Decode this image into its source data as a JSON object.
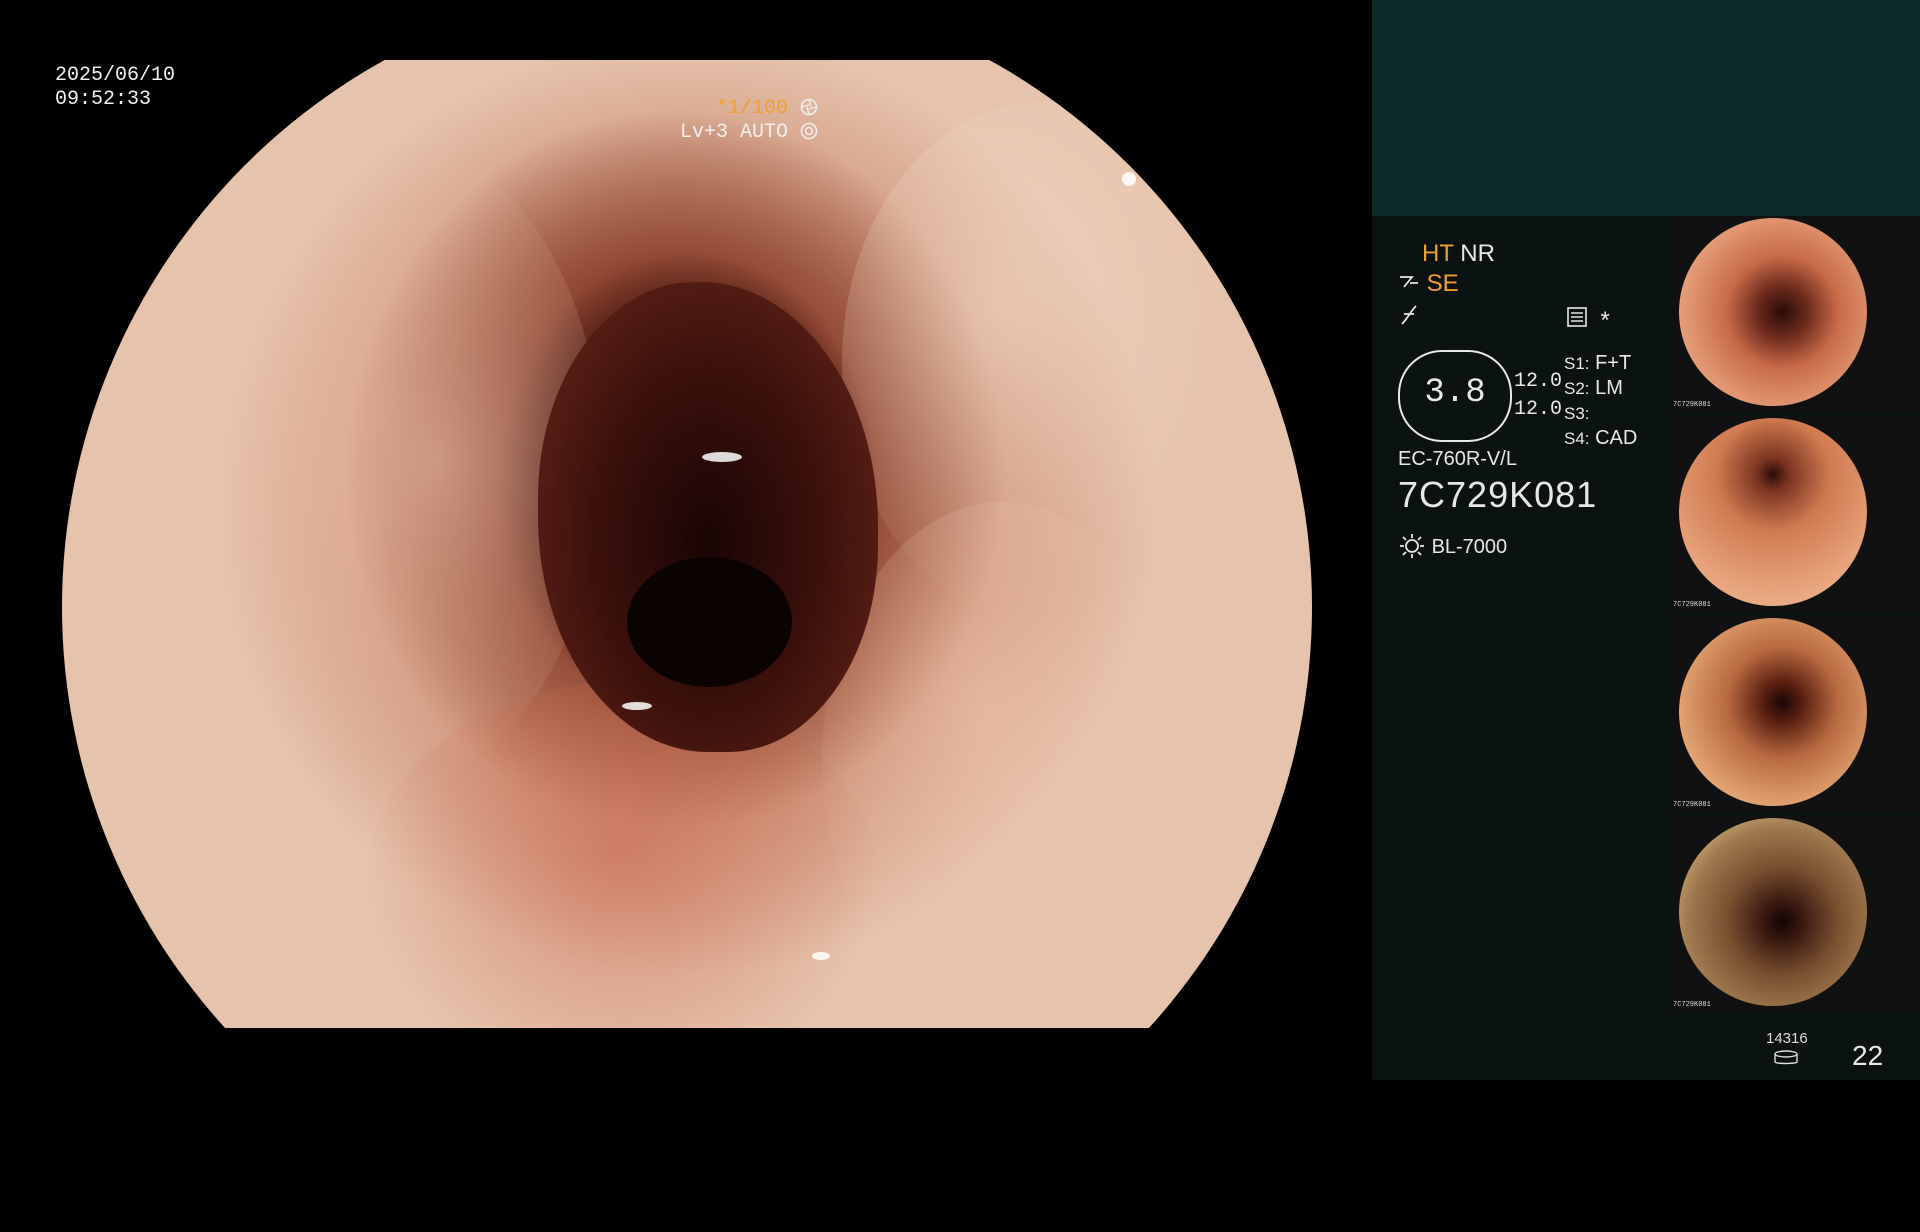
{
  "overlay": {
    "date": "2025/06/10",
    "time": "09:52:33",
    "shutter_value": "*1/100",
    "shutter_icon": "aperture-icon",
    "level_value": "Lv+3 AUTO",
    "level_icon": "auto-exposure-icon"
  },
  "panel": {
    "ht_label": "HT",
    "nr_label": "NR",
    "se_label": "SE",
    "se_icon": "structure-enhance-icon",
    "freeze_icon": "freeze-icon",
    "memo_icon": "document-icon",
    "asterisk": "*",
    "scope_value": "3.8",
    "ch1": "12.0",
    "ch2": "12.0",
    "s1_label": "S1:",
    "s1_value": "F+T",
    "s2_label": "S2:",
    "s2_value": "LM",
    "s3_label": "S3:",
    "s3_value": "",
    "s4_label": "S4:",
    "s4_value": "CAD",
    "scope_model": "EC-760R-V/L",
    "serial": "7C729K081",
    "light_source": "BL-7000",
    "light_icon": "light-source-icon"
  },
  "thumbnails": [
    {
      "label": "7C729K081"
    },
    {
      "label": "7C729K081"
    },
    {
      "label": "7C729K081"
    },
    {
      "label": "7C729K081"
    }
  ],
  "footer": {
    "image_count": "14316",
    "storage_icon": "storage-icon",
    "page_number": "22"
  }
}
